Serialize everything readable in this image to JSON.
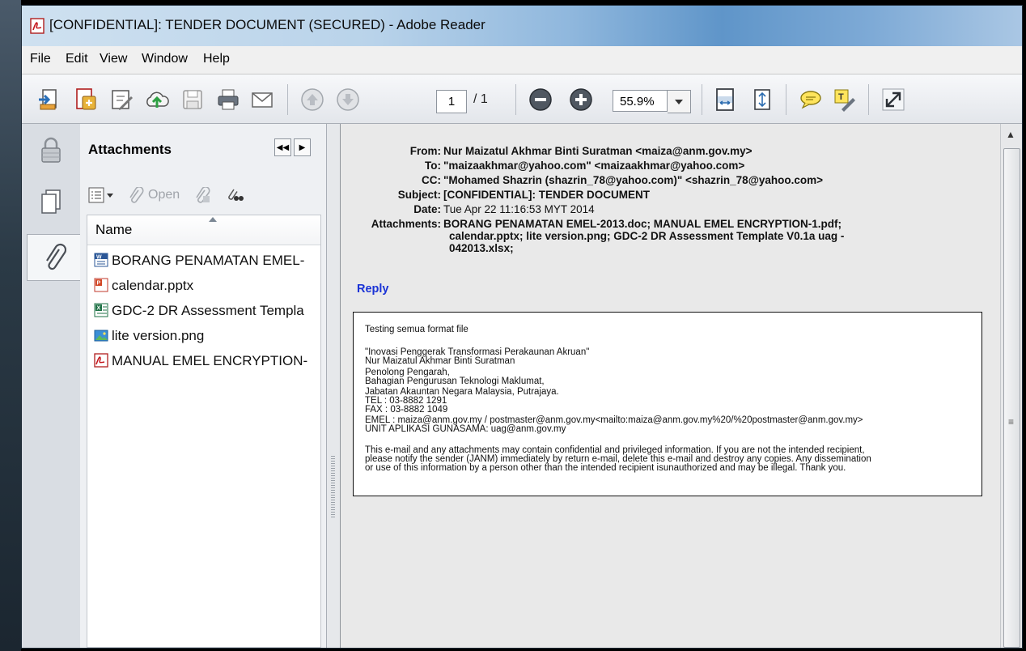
{
  "window": {
    "title": "[CONFIDENTIAL]: TENDER DOCUMENT (SECURED) - Adobe Reader"
  },
  "menu": [
    "File",
    "Edit",
    "View",
    "Window",
    "Help"
  ],
  "toolbar": {
    "page_current": "1",
    "page_total": "/ 1",
    "zoom": "55.9%",
    "icons": [
      "open-icon",
      "create-pdf-icon",
      "edit-icon",
      "cloud-upload-icon",
      "save-icon",
      "print-icon",
      "email-icon",
      "previous-page-icon",
      "next-page-icon",
      "zoom-out-icon",
      "zoom-in-icon",
      "fit-page-icon",
      "fit-width-icon",
      "comment-icon",
      "highlight-icon",
      "full-screen-icon"
    ]
  },
  "sidebar": {
    "title": "Attachments",
    "open_label": "Open",
    "column_header": "Name",
    "items": [
      {
        "name": "BORANG PENAMATAN EMEL-",
        "icon": "word-file-icon"
      },
      {
        "name": "calendar.pptx",
        "icon": "powerpoint-file-icon"
      },
      {
        "name": "GDC-2 DR Assessment Templa",
        "icon": "excel-file-icon"
      },
      {
        "name": "lite version.png",
        "icon": "image-file-icon"
      },
      {
        "name": "MANUAL EMEL ENCRYPTION-",
        "icon": "pdf-file-icon"
      }
    ]
  },
  "email": {
    "from_label": "From:",
    "from": "Nur Maizatul Akhmar Binti Suratman <maiza@anm.gov.my>",
    "to_label": "To:",
    "to": "\"maizaakhmar@yahoo.com\" <maizaakhmar@yahoo.com>",
    "cc_label": "CC:",
    "cc": "\"Mohamed Shazrin (shazrin_78@yahoo.com)\" <shazrin_78@yahoo.com>",
    "subject_label": "Subject:",
    "subject": "[CONFIDENTIAL]: TENDER DOCUMENT",
    "date_label": "Date:",
    "date": "Tue Apr 22 11:16:53 MYT 2014",
    "attachments_label": "Attachments:",
    "attachments_lines": [
      "BORANG PENAMATAN EMEL-2013.doc; MANUAL EMEL ENCRYPTION-1.pdf;",
      "calendar.pptx; lite version.png; GDC-2 DR Assessment Template V0.1a uag -",
      "042013.xlsx;"
    ],
    "reply": "Reply",
    "body_lines": [
      "Testing semua format file",
      "",
      "\"Inovasi Penggerak Transformasi Perakaunan Akruan\"",
      "Nur Maizatul Akhmar Binti Suratman",
      "Penolong Pengarah,",
      "Bahagian Pengurusan Teknologi Maklumat,",
      "Jabatan Akauntan Negara Malaysia, Putrajaya.",
      "TEL : 03-8882 1291",
      "FAX : 03-8882 1049",
      "EMEL : maiza@anm.gov.my / postmaster@anm.gov.my<mailto:maiza@anm.gov.my%20/%20postmaster@anm.gov.my>",
      "UNIT  APLIKASI GUNASAMA: uag@anm.gov.my",
      "",
      "This e-mail and any attachments may contain confidential and privileged information. If you are not the intended recipient,",
      "please notify the sender (JANM) immediately by return e-mail, delete this e-mail and destroy any copies. Any dissemination",
      "or use of this information by a person other than the intended recipient isunauthorized and may be illegal. Thank you."
    ]
  }
}
